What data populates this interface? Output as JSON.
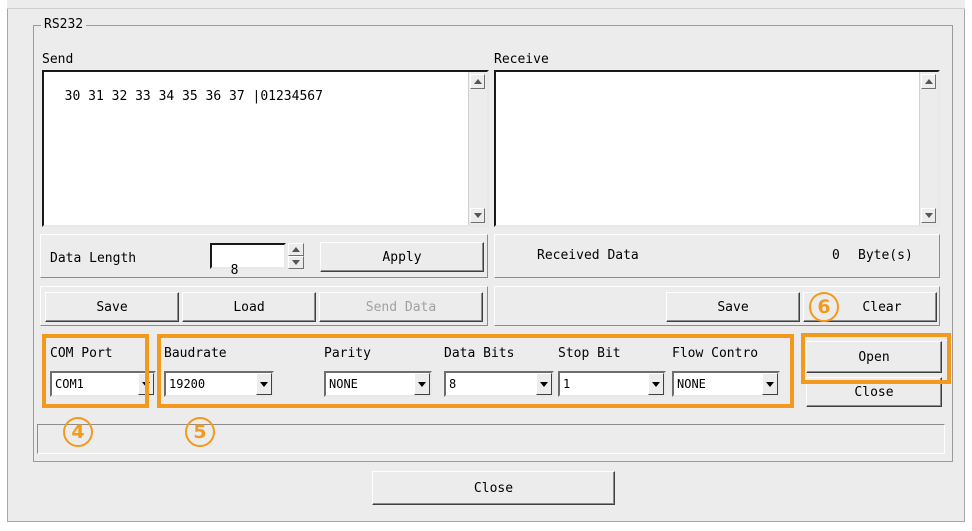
{
  "group_title": "RS232",
  "send": {
    "label": "Send",
    "content": "30 31 32 33 34 35 36 37 |01234567"
  },
  "receive": {
    "label": "Receive",
    "content": ""
  },
  "data_length": {
    "label": "Data Length",
    "value": "8",
    "apply_label": "Apply"
  },
  "received": {
    "label": "Received Data",
    "count": "0",
    "unit": "Byte(s)"
  },
  "send_buttons": {
    "save": "Save",
    "load": "Load",
    "send_data": "Send Data"
  },
  "receive_buttons": {
    "save": "Save",
    "clear": "Clear"
  },
  "settings": {
    "com_port": {
      "label": "COM Port",
      "value": "COM1"
    },
    "baudrate": {
      "label": "Baudrate",
      "value": "19200"
    },
    "parity": {
      "label": "Parity",
      "value": "NONE"
    },
    "data_bits": {
      "label": "Data Bits",
      "value": "8"
    },
    "stop_bit": {
      "label": "Stop Bit",
      "value": "1"
    },
    "flow_control": {
      "label": "Flow Contro",
      "value": "NONE"
    }
  },
  "port_buttons": {
    "open": "Open",
    "close": "Close"
  },
  "dialog_close": "Close",
  "markers": {
    "m4": "4",
    "m5": "5",
    "m6": "6"
  },
  "colors": {
    "highlight": "#f39a1d",
    "dialog_bg": "#ececec"
  }
}
